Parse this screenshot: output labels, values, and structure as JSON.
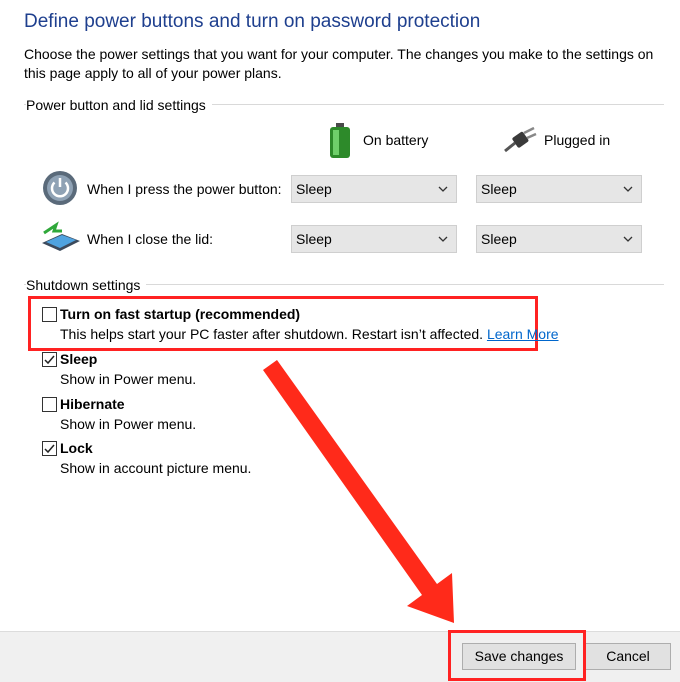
{
  "page": {
    "title": "Define power buttons and turn on password protection",
    "intro": "Choose the power settings that you want for your computer. The changes you make to the settings on this page apply to all of your power plans."
  },
  "power_section": {
    "label": "Power button and lid settings",
    "columns": {
      "battery": "On battery",
      "plugged": "Plugged in"
    },
    "rows": [
      {
        "label": "When I press the power button:",
        "battery": "Sleep",
        "plugged": "Sleep",
        "icon": "power-button-icon"
      },
      {
        "label": "When I close the lid:",
        "battery": "Sleep",
        "plugged": "Sleep",
        "icon": "laptop-lid-icon"
      }
    ]
  },
  "shutdown_section": {
    "label": "Shutdown settings",
    "options": [
      {
        "title": "Turn on fast startup (recommended)",
        "desc": "This helps start your PC faster after shutdown. Restart isn’t affected.",
        "link": "Learn More",
        "checked": false
      },
      {
        "title": "Sleep",
        "desc": "Show in Power menu.",
        "checked": true
      },
      {
        "title": "Hibernate",
        "desc": "Show in Power menu.",
        "checked": false
      },
      {
        "title": "Lock",
        "desc": "Show in account picture menu.",
        "checked": true
      }
    ]
  },
  "footer": {
    "save": "Save changes",
    "cancel": "Cancel"
  },
  "colors": {
    "title": "#1e3f8e",
    "link": "#0066cc",
    "annotation": "#ff2a1a"
  }
}
